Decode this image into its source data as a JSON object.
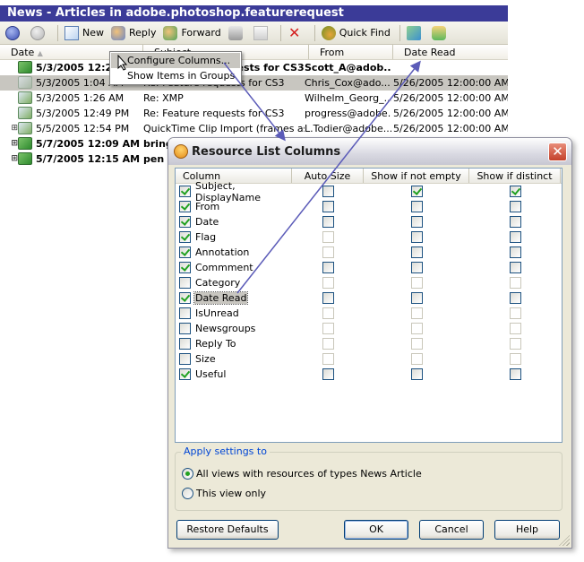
{
  "main_window": {
    "title": "News - Articles in adobe.photoshop.featurerequest",
    "toolbar": {
      "new_label": "New",
      "reply_label": "Reply",
      "forward_label": "Forward",
      "quick_find_label": "Quick Find"
    },
    "columns": {
      "date": "Date",
      "subject": "Subject",
      "from": "From",
      "date_read": "Date Read"
    },
    "rows": [
      {
        "expander": "",
        "icon": "news-unread-icon",
        "date": "5/3/2005 12:22 AM",
        "subject": "Re: Feature requests for CS3",
        "from": "Scott_A@adob...",
        "date_read": "",
        "bold": true,
        "selected": false
      },
      {
        "expander": "",
        "icon": "news-read-icon",
        "date": "5/3/2005 1:04 AM",
        "subject": "Re: Feature requests for CS3",
        "from": "Chris_Cox@ado...",
        "date_read": "5/26/2005 12:00:00 AM",
        "bold": false,
        "selected": true
      },
      {
        "expander": "",
        "icon": "news-read-icon",
        "date": "5/3/2005 1:26 AM",
        "subject": "Re: XMP",
        "from": "Wilhelm_Georg_...",
        "date_read": "5/26/2005 12:00:00 AM",
        "bold": false,
        "selected": false
      },
      {
        "expander": "",
        "icon": "news-read-icon",
        "date": "5/3/2005 12:49 PM",
        "subject": "Re: Feature requests for CS3",
        "from": "progress@adobe...",
        "date_read": "5/26/2005 12:00:00 AM",
        "bold": false,
        "selected": false
      },
      {
        "expander": "⊞",
        "icon": "news-read-icon",
        "date": "5/5/2005 12:54 PM",
        "subject": "QuickTime Clip Import (frames as l...",
        "from": "L.Todier@adobe...",
        "date_read": "5/26/2005 12:00:00 AM",
        "bold": false,
        "selected": false
      },
      {
        "expander": "⊞",
        "icon": "news-unread-icon",
        "date": "5/7/2005 12:09 AM",
        "subject": "bring",
        "from": "",
        "date_read": "",
        "bold": true,
        "selected": false
      },
      {
        "expander": "⊞",
        "icon": "news-unread-icon",
        "date": "5/7/2005 12:15 AM",
        "subject": "pen",
        "from": "",
        "date_read": "",
        "bold": true,
        "selected": false
      }
    ]
  },
  "context_menu": {
    "items": [
      {
        "label": "Configure Columns...",
        "highlighted": true
      },
      {
        "label": "Show Items in Groups",
        "highlighted": false
      }
    ]
  },
  "dialog": {
    "title": "Resource List Columns",
    "headers": {
      "column": "Column",
      "auto_size": "Auto Size",
      "show_if_not_empty": "Show if not empty",
      "show_if_distinct": "Show if distinct"
    },
    "rows": [
      {
        "name": "Subject, DisplayName",
        "visible": true,
        "auto_size": false,
        "auto_size_enabled": true,
        "not_empty": true,
        "distinct": true,
        "options_enabled": true
      },
      {
        "name": "From",
        "visible": true,
        "auto_size": false,
        "auto_size_enabled": true,
        "not_empty": false,
        "distinct": false,
        "options_enabled": true
      },
      {
        "name": "Date",
        "visible": true,
        "auto_size": false,
        "auto_size_enabled": true,
        "not_empty": false,
        "distinct": false,
        "options_enabled": true
      },
      {
        "name": "Flag",
        "visible": true,
        "auto_size": false,
        "auto_size_enabled": false,
        "not_empty": false,
        "distinct": false,
        "options_enabled": true
      },
      {
        "name": "Annotation",
        "visible": true,
        "auto_size": false,
        "auto_size_enabled": false,
        "not_empty": false,
        "distinct": false,
        "options_enabled": true
      },
      {
        "name": "Commment",
        "visible": true,
        "auto_size": false,
        "auto_size_enabled": true,
        "not_empty": false,
        "distinct": false,
        "options_enabled": true
      },
      {
        "name": "Category",
        "visible": false,
        "auto_size": false,
        "auto_size_enabled": false,
        "not_empty": false,
        "distinct": false,
        "options_enabled": false
      },
      {
        "name": "Date Read",
        "visible": true,
        "auto_size": false,
        "auto_size_enabled": true,
        "not_empty": false,
        "distinct": false,
        "options_enabled": true,
        "focused": true
      },
      {
        "name": "IsUnread",
        "visible": false,
        "auto_size": false,
        "auto_size_enabled": false,
        "not_empty": false,
        "distinct": false,
        "options_enabled": false
      },
      {
        "name": "Newsgroups",
        "visible": false,
        "auto_size": false,
        "auto_size_enabled": false,
        "not_empty": false,
        "distinct": false,
        "options_enabled": false
      },
      {
        "name": "Reply To",
        "visible": false,
        "auto_size": false,
        "auto_size_enabled": false,
        "not_empty": false,
        "distinct": false,
        "options_enabled": false
      },
      {
        "name": "Size",
        "visible": false,
        "auto_size": false,
        "auto_size_enabled": false,
        "not_empty": false,
        "distinct": false,
        "options_enabled": false
      },
      {
        "name": "Useful",
        "visible": true,
        "auto_size": false,
        "auto_size_enabled": true,
        "not_empty": false,
        "distinct": false,
        "options_enabled": true
      }
    ],
    "apply_group": {
      "legend": "Apply settings to",
      "options": [
        {
          "label": "All views with resources of types News Article",
          "selected": true
        },
        {
          "label": "This view only",
          "selected": false
        }
      ]
    },
    "buttons": {
      "restore_defaults": "Restore Defaults",
      "ok": "OK",
      "cancel": "Cancel",
      "help": "Help"
    },
    "close_glyph": "✕"
  },
  "colors": {
    "title_bar": "#3b3b98",
    "arrow": "#5b5bb8",
    "check": "#21a121",
    "legend_text": "#0046d5"
  }
}
